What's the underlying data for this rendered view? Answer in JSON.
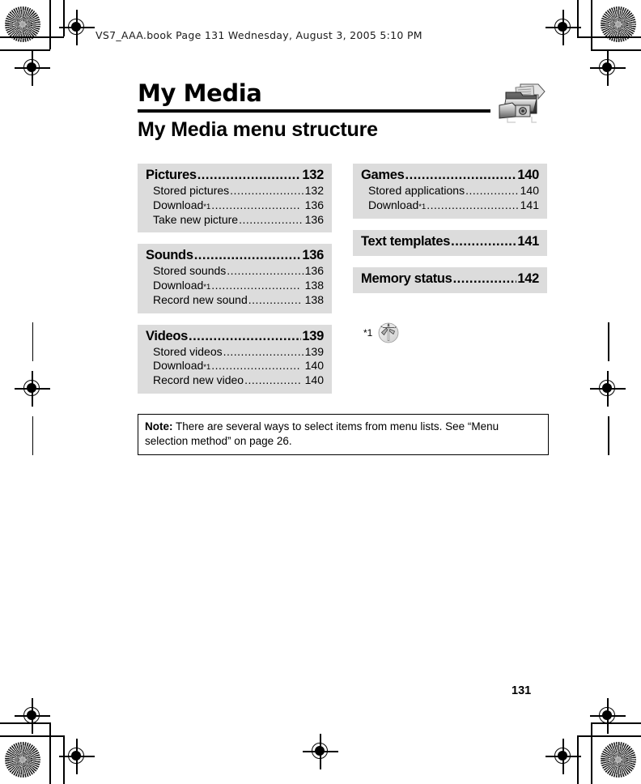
{
  "page": {
    "header_line": "VS7_AAA.book  Page 131  Wednesday, August 3, 2005  5:10 PM",
    "chapter_title": "My Media",
    "section_title": "My Media menu structure",
    "page_number": "131",
    "box_color": "#dcdcdc",
    "chapter_icon": "media-folder-icon"
  },
  "columns": {
    "left": [
      {
        "name": "pictures-box",
        "heading": {
          "label": "Pictures",
          "dots": "..........................",
          "page": "132"
        },
        "items": [
          {
            "label": "Stored pictures",
            "footnote": "",
            "dots": ".....................",
            "page": "132"
          },
          {
            "label": "Download",
            "footnote": "*1",
            "dots": ".........................",
            "page": "136"
          },
          {
            "label": "Take new picture",
            "footnote": "",
            "dots": "..................",
            "page": "136"
          }
        ]
      },
      {
        "name": "sounds-box",
        "heading": {
          "label": "Sounds",
          "dots": "...........................",
          "page": "136"
        },
        "items": [
          {
            "label": "Stored sounds",
            "footnote": "",
            "dots": "......................",
            "page": "136"
          },
          {
            "label": "Download",
            "footnote": "*1",
            "dots": ".........................",
            "page": "138"
          },
          {
            "label": "Record new sound",
            "footnote": "",
            "dots": "...............",
            "page": "138"
          }
        ]
      },
      {
        "name": "videos-box",
        "heading": {
          "label": "Videos",
          "dots": "............................",
          "page": "139"
        },
        "items": [
          {
            "label": "Stored videos",
            "footnote": "",
            "dots": ".......................",
            "page": "139"
          },
          {
            "label": "Download",
            "footnote": "*1",
            "dots": ".........................",
            "page": "140"
          },
          {
            "label": "Record new video",
            "footnote": "",
            "dots": "................",
            "page": "140"
          }
        ]
      }
    ],
    "right": [
      {
        "name": "games-box",
        "heading": {
          "label": "Games",
          "dots": "............................",
          "page": "140"
        },
        "items": [
          {
            "label": "Stored applications",
            "footnote": "",
            "dots": "...............",
            "page": "140"
          },
          {
            "label": "Download",
            "footnote": "*1",
            "dots": "..........................",
            "page": "141"
          }
        ]
      },
      {
        "name": "text-templates-box",
        "heading": {
          "label": "Text templates",
          "dots": "................",
          "page": "141"
        },
        "items": []
      },
      {
        "name": "memory-status-box",
        "heading": {
          "label": "Memory status",
          "dots": "................",
          "page": "142"
        },
        "items": []
      }
    ]
  },
  "footnote": {
    "mark": "*1",
    "icon": "satellite-network-icon"
  },
  "note": {
    "label": "Note:",
    "text": " There are several ways to select items from menu lists. See “Menu selection method” on page 26."
  }
}
